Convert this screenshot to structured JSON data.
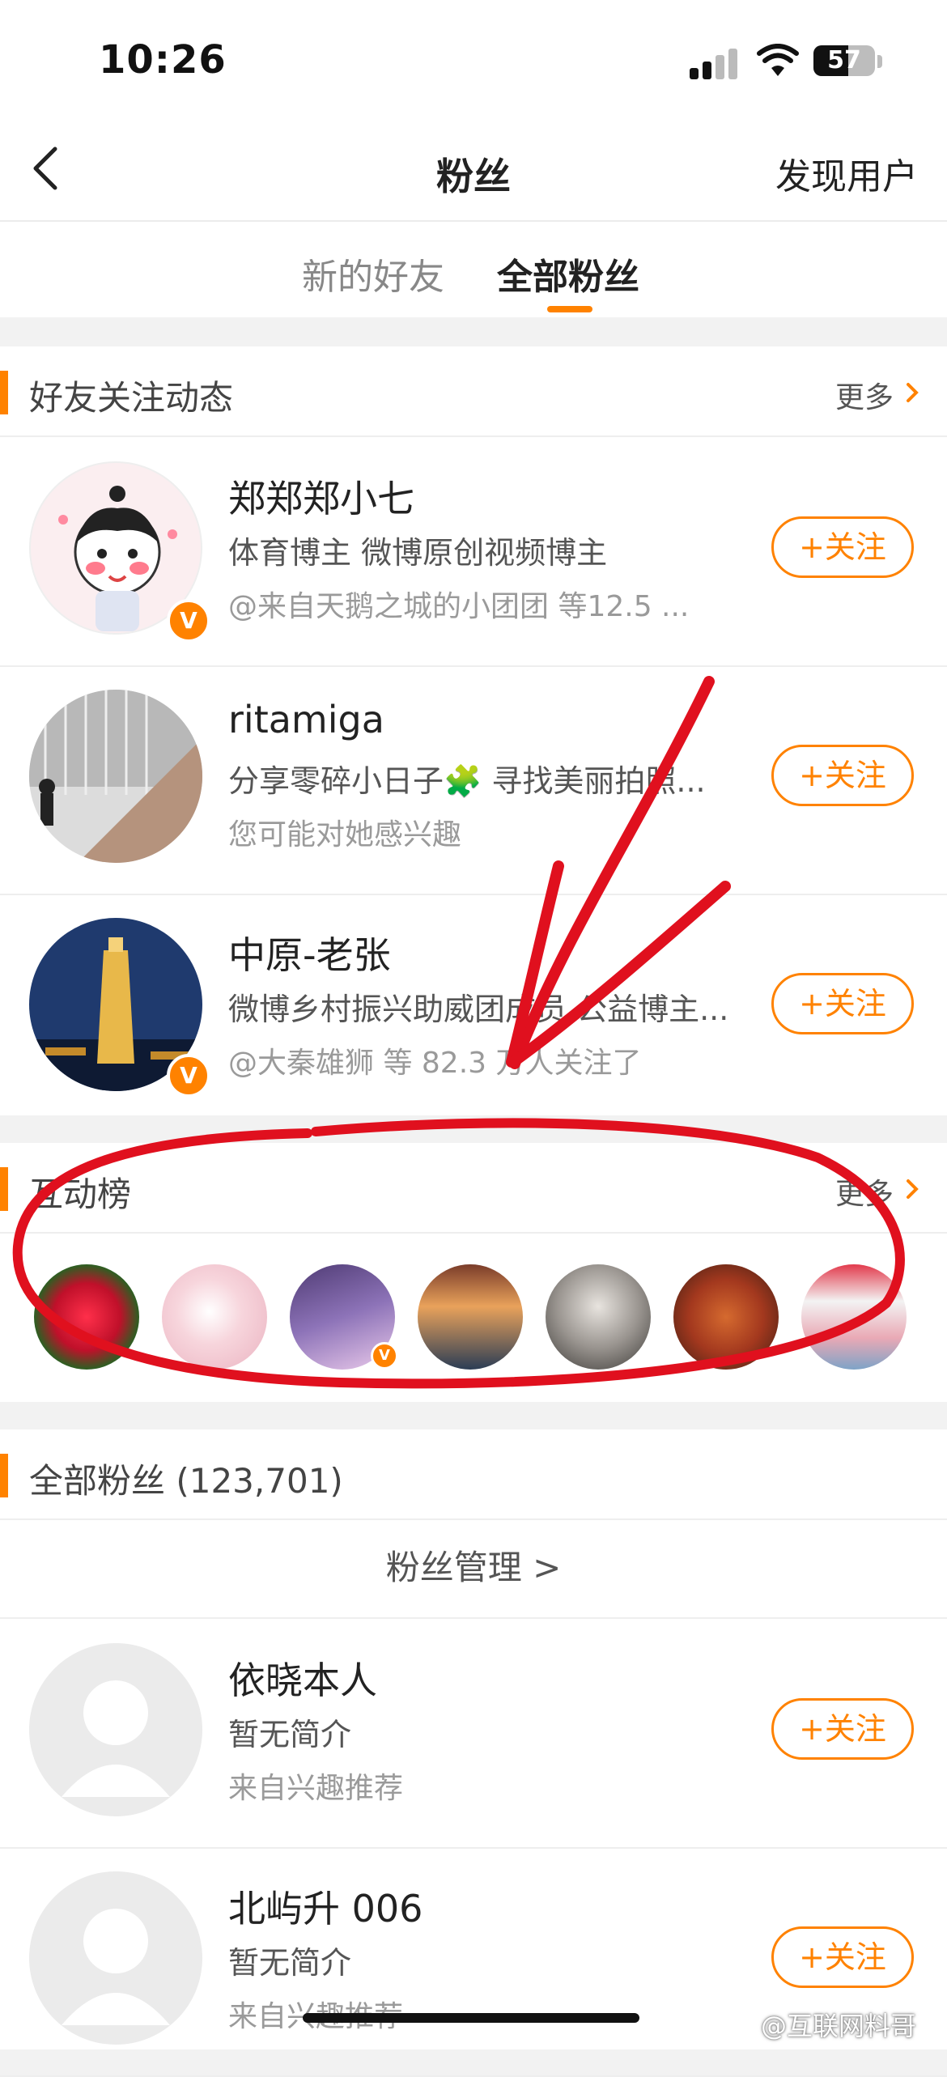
{
  "status": {
    "time": "10:26",
    "battery": "57",
    "battery_level": 0.57
  },
  "nav": {
    "title": "粉丝",
    "right": "发现用户"
  },
  "tabs": [
    {
      "label": "新的好友"
    },
    {
      "label": "全部粉丝"
    }
  ],
  "friends_section": {
    "title": "好友关注动态",
    "more": "更多",
    "users": [
      {
        "name": "郑郑郑小七",
        "bio": "体育博主 微博原创视频博主",
        "meta": "@来自天鹅之城的小团团 等12.5 ...",
        "button": "+关注",
        "verified": true
      },
      {
        "name": "ritamiga",
        "bio": "分享零碎小日子🧩 寻找美丽拍照...",
        "meta": "您可能对她感兴趣",
        "button": "+关注",
        "verified": false
      },
      {
        "name": "中原-老张",
        "bio": "微博乡村振兴助威团成员 公益博主...",
        "meta": "@大秦雄狮 等 82.3 万人关注了",
        "button": "+关注",
        "verified": true
      }
    ]
  },
  "ranklist": {
    "title": "互动榜",
    "more": "更多"
  },
  "all_fans": {
    "title": "全部粉丝 (123,701)",
    "manage": "粉丝管理  >",
    "users": [
      {
        "name": "依晓本人",
        "bio": "暂无简介",
        "meta": "来自兴趣推荐",
        "button": "+关注"
      },
      {
        "name": "北屿升 006",
        "bio": "暂无简介",
        "meta": "来自兴趣推荐",
        "button": "+关注"
      }
    ]
  },
  "watermark": "@互联网料哥",
  "colors": {
    "accent": "#ff8200",
    "annotation": "#e0101e"
  }
}
